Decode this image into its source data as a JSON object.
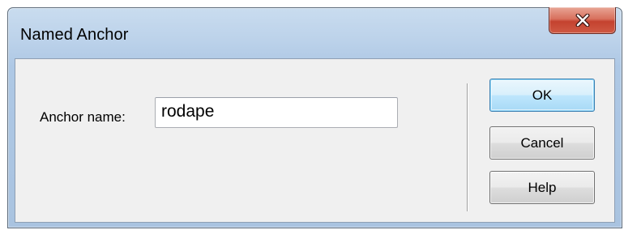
{
  "window": {
    "title": "Named Anchor",
    "close_icon": "close-x-icon"
  },
  "form": {
    "anchor_label": "Anchor name:",
    "anchor_value": "rodape"
  },
  "buttons": {
    "ok": "OK",
    "cancel": "Cancel",
    "help": "Help"
  },
  "colors": {
    "title_bar": "#bcd2ea",
    "close_button": "#c4422f",
    "default_button_border": "#3c7fb1"
  }
}
